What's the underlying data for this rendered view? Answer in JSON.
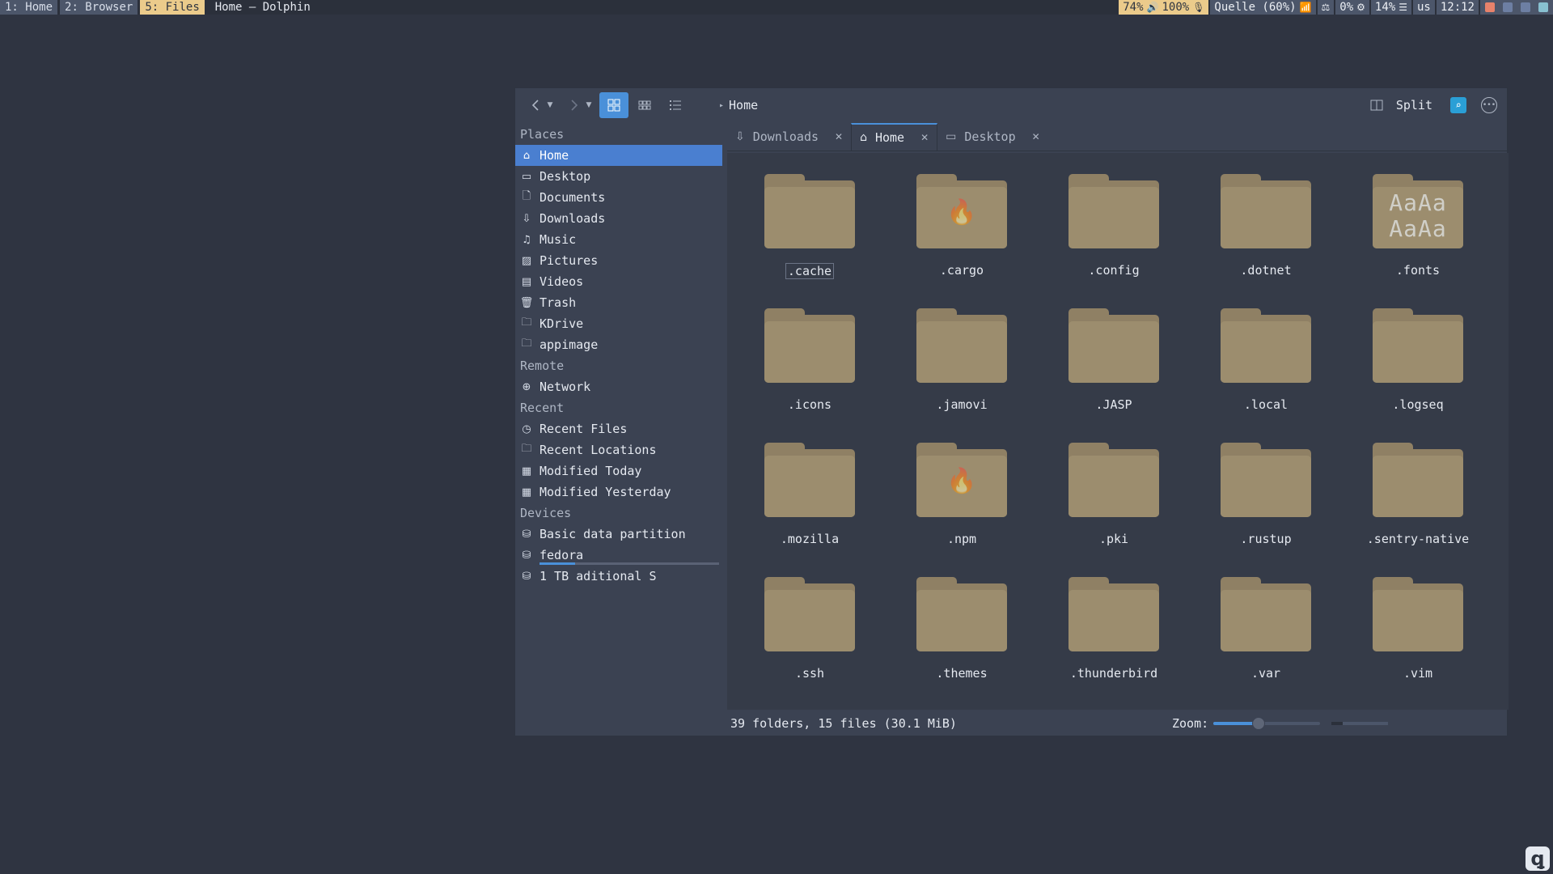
{
  "topbar": {
    "workspaces": [
      {
        "label": "1: Home",
        "active": false
      },
      {
        "label": "2: Browser",
        "active": false
      },
      {
        "label": "5: Files",
        "active": true
      }
    ],
    "window_title": "Home — Dolphin",
    "status": {
      "volume": "74%",
      "mic": "100%",
      "wifi": "Quelle (60%)",
      "cpu": "0%",
      "memory": "14%",
      "keyboard_layout": "us",
      "clock": "12:12"
    }
  },
  "toolbar": {
    "breadcrumb": "Home",
    "split_label": "Split"
  },
  "places": {
    "sections": {
      "places": "Places",
      "remote": "Remote",
      "recent": "Recent",
      "devices": "Devices"
    },
    "items": [
      {
        "label": "Home",
        "icon": "home-icon",
        "active": true
      },
      {
        "label": "Desktop",
        "icon": "desktop-icon"
      },
      {
        "label": "Documents",
        "icon": "document-icon"
      },
      {
        "label": "Downloads",
        "icon": "download-icon"
      },
      {
        "label": "Music",
        "icon": "music-icon"
      },
      {
        "label": "Pictures",
        "icon": "picture-icon"
      },
      {
        "label": "Videos",
        "icon": "video-icon"
      },
      {
        "label": "Trash",
        "icon": "trash-icon"
      },
      {
        "label": "KDrive",
        "icon": "folder-icon"
      },
      {
        "label": "appimage",
        "icon": "folder-icon"
      }
    ],
    "remote": [
      {
        "label": "Network",
        "icon": "network-icon"
      }
    ],
    "recent": [
      {
        "label": "Recent Files",
        "icon": "clock-icon"
      },
      {
        "label": "Recent Locations",
        "icon": "folder-clock-icon"
      },
      {
        "label": "Modified Today",
        "icon": "calendar-icon"
      },
      {
        "label": "Modified Yesterday",
        "icon": "calendar-icon"
      }
    ],
    "devices": [
      {
        "label": "Basic data partition",
        "icon": "drive-icon"
      },
      {
        "label": "fedora",
        "icon": "drive-icon",
        "usage": 0.2
      },
      {
        "label": "1 TB aditional S",
        "icon": "drive-icon"
      }
    ]
  },
  "tabs": [
    {
      "label": "Downloads",
      "icon": "download-icon",
      "active": false
    },
    {
      "label": "Home",
      "icon": "home-icon",
      "active": true
    },
    {
      "label": "Desktop",
      "icon": "desktop-icon",
      "active": false
    }
  ],
  "files": [
    {
      "name": ".cache",
      "emblem": ""
    },
    {
      "name": ".cargo",
      "emblem": "flame"
    },
    {
      "name": ".config",
      "emblem": ""
    },
    {
      "name": ".dotnet",
      "emblem": ""
    },
    {
      "name": ".fonts",
      "emblem": "fonts"
    },
    {
      "name": ".icons",
      "emblem": ""
    },
    {
      "name": ".jamovi",
      "emblem": ""
    },
    {
      "name": ".JASP",
      "emblem": ""
    },
    {
      "name": ".local",
      "emblem": ""
    },
    {
      "name": ".logseq",
      "emblem": ""
    },
    {
      "name": ".mozilla",
      "emblem": ""
    },
    {
      "name": ".npm",
      "emblem": "flame"
    },
    {
      "name": ".pki",
      "emblem": ""
    },
    {
      "name": ".rustup",
      "emblem": ""
    },
    {
      "name": ".sentry-native",
      "emblem": ""
    },
    {
      "name": ".ssh",
      "emblem": ""
    },
    {
      "name": ".themes",
      "emblem": ""
    },
    {
      "name": ".thunderbird",
      "emblem": ""
    },
    {
      "name": ".var",
      "emblem": ""
    },
    {
      "name": ".vim",
      "emblem": ""
    }
  ],
  "fonts_emblem_text": "AaAa",
  "statusbar": {
    "summary": "39 folders, 15 files (30.1 MiB)",
    "zoom_label": "Zoom:",
    "zoom_level": 0.42
  },
  "colors": {
    "accent": "#4a90d9",
    "folder": "#9c8d6e",
    "workspace_active": "#ebcb8b"
  }
}
